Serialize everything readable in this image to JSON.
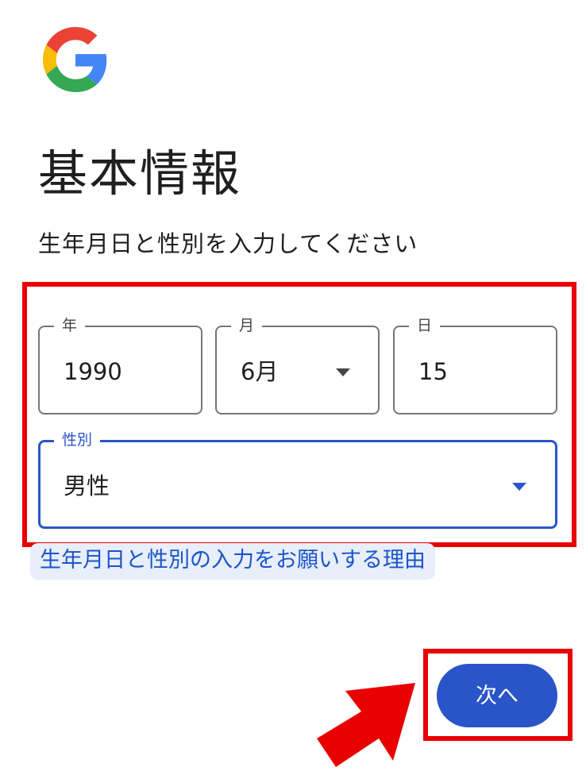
{
  "page": {
    "title": "基本情報",
    "subtitle": "生年月日と性別を入力してください"
  },
  "fields": {
    "year": {
      "label": "年",
      "value": "1990"
    },
    "month": {
      "label": "月",
      "value": "6月"
    },
    "day": {
      "label": "日",
      "value": "15"
    },
    "gender": {
      "label": "性別",
      "value": "男性"
    }
  },
  "links": {
    "reason": "生年月日と性別の入力をお願いする理由"
  },
  "buttons": {
    "next": "次へ"
  },
  "icons": {
    "logo": "google-logo-icon",
    "month_dropdown": "chevron-down-icon",
    "gender_dropdown": "chevron-down-icon",
    "annotation_arrow": "red-arrow-icon"
  },
  "colors": {
    "accent": "#2a55c8",
    "annotation": "#e90000",
    "link_bg": "#e8eefa",
    "outline": "#747775"
  }
}
